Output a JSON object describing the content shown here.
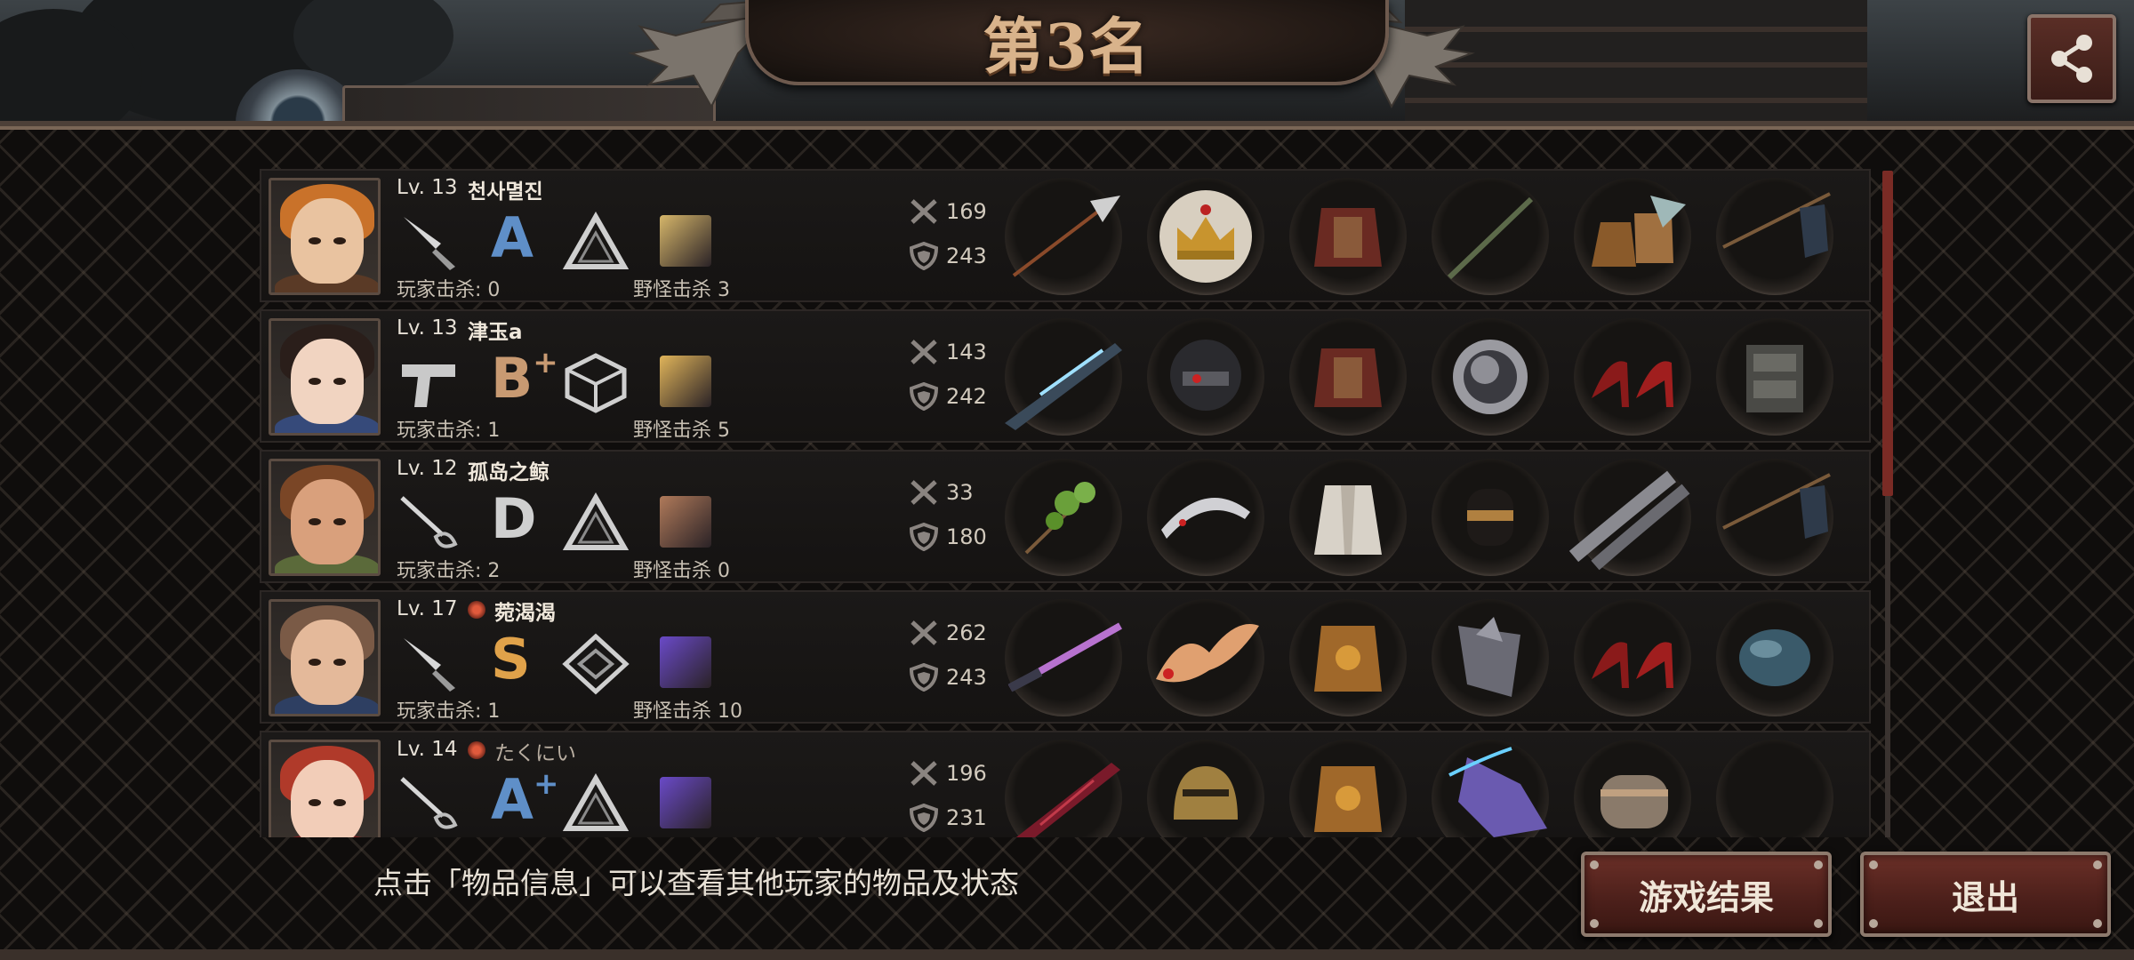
{
  "header": {
    "rank_title": "第3名",
    "profile_name_partial": "孤岛之鲸"
  },
  "players": [
    {
      "level": "Lv. 13",
      "name": "천사멸진",
      "clan_badge": false,
      "grade": "A",
      "grade_plus": "",
      "grade_color": "#5f8fc8",
      "player_kills": "玩家击杀: 0",
      "monster_kills": "野怪击杀 3",
      "attack": "169",
      "defense": "243",
      "skin": "#e9c3a0",
      "hair": "#c9722a",
      "outfit": "#5a3a26",
      "weapon": "knife-icon",
      "type": "triangle-icon",
      "pet": "#d6b66a",
      "equipment": [
        "spear-icon",
        "crown-icon",
        "armor-icon",
        "sword-icon",
        "boots-icon",
        "flag-icon"
      ]
    },
    {
      "level": "Lv. 13",
      "name": "津玉a",
      "clan_badge": false,
      "grade": "B",
      "grade_plus": "+",
      "grade_color": "#c89a72",
      "player_kills": "玩家击杀: 1",
      "monster_kills": "野怪击杀 5",
      "attack": "143",
      "defense": "242",
      "skin": "#f1d4c1",
      "hair": "#2a1e1a",
      "outfit": "#364a7a",
      "weapon": "pistol-icon",
      "type": "cube-icon",
      "pet": "#e0b45a",
      "equipment": [
        "rifle-icon",
        "helmet-icon",
        "armor-icon",
        "disc-icon",
        "heels-icon",
        "vest-icon"
      ]
    },
    {
      "level": "Lv. 12",
      "name": "孤岛之鲸",
      "clan_badge": false,
      "grade": "D",
      "grade_plus": "",
      "grade_color": "#cfcfcf",
      "player_kills": "玩家击杀: 2",
      "monster_kills": "野怪击杀 0",
      "attack": "33",
      "defense": "180",
      "skin": "#d9a07c",
      "hair": "#7a4626",
      "outfit": "#5b6a3a",
      "weapon": "rapier-icon",
      "type": "triangle-icon",
      "pet": "#b07a5a",
      "equipment": [
        "branch-icon",
        "tiara-icon",
        "robe-icon",
        "glove-icon",
        "chain-icon",
        "flag-icon"
      ]
    },
    {
      "level": "Lv. 17",
      "name": "菀渴渴",
      "clan_badge": true,
      "grade": "S",
      "grade_plus": "",
      "grade_color": "#e0a24a",
      "player_kills": "玩家击杀: 1",
      "monster_kills": "野怪击杀 10",
      "attack": "262",
      "defense": "243",
      "skin": "#e4b99a",
      "hair": "#7a5a46",
      "outfit": "#2e3f62",
      "weapon": "knife-icon",
      "type": "diamond-icon",
      "pet": "#6a4ac8",
      "equipment": [
        "lightsaber-icon",
        "wings-icon",
        "gold-armor-icon",
        "gauntlet-icon",
        "heels-icon",
        "orb-icon"
      ]
    },
    {
      "level": "Lv. 14",
      "name": "たくにい",
      "clan_badge": true,
      "grade": "A",
      "grade_plus": "+",
      "grade_color": "#5f8fc8",
      "player_kills": "",
      "monster_kills": "",
      "attack": "196",
      "defense": "231",
      "skin": "#f2cdb8",
      "hair": "#b03a2a",
      "outfit": "#7a2222",
      "weapon": "rapier-icon",
      "type": "triangle-icon",
      "pet": "#6a4ac8",
      "equipment": [
        "blade-icon",
        "knight-helmet-icon",
        "gold-armor-icon",
        "crystal-icon",
        "armguard-icon",
        "empty-slot"
      ]
    }
  ],
  "footer": {
    "hint": "点击「物品信息」可以查看其他玩家的物品及状态",
    "results_button": "游戏结果",
    "exit_button": "退出"
  },
  "colors": {
    "accent": "#7a2b25",
    "banner_text": "#d9b38b",
    "button_bg": "#4b1f1a"
  }
}
